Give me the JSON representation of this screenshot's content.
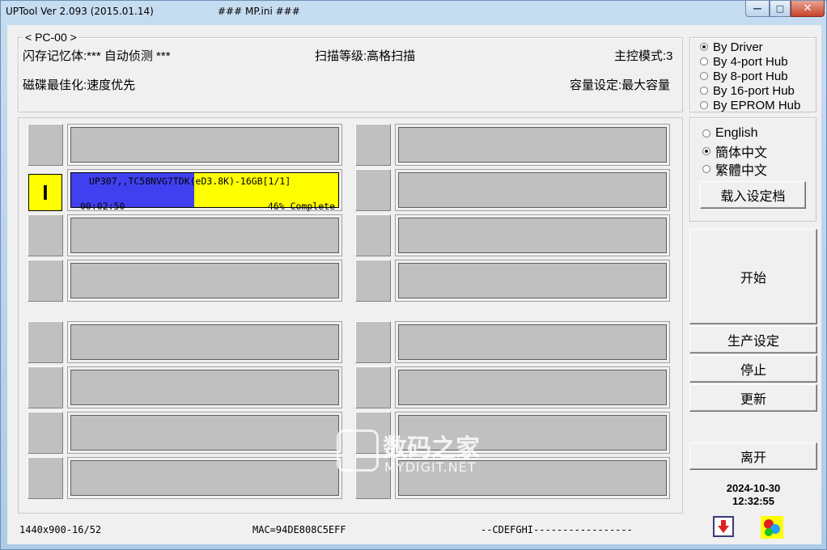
{
  "window": {
    "title": "UPTool Ver 2.093 (2015.01.14)",
    "subtitle": "### MP.ini ###",
    "buttons": {
      "minimize": "—",
      "maximize": "□",
      "close": "✕"
    }
  },
  "info": {
    "group_label": "< PC-00 >",
    "flash": "闪存记忆体:*** 自动侦测 ***",
    "scan": "扫描等级:高格扫描",
    "mode": "主控模式:3",
    "optimize": "磁碟最佳化:速度优先",
    "capacity": "容量设定:最大容量"
  },
  "ports": {
    "active": {
      "slot": 2,
      "indicator": "I",
      "line1": "UP307,,TC58NVG7TDK(eD3.8K)-16GB[1/1]",
      "time": "00:02:50",
      "status": "46% Complete",
      "progress": 0.46,
      "fill_color": "#4040f0",
      "bg_color": "#ffff00"
    },
    "count": 16
  },
  "hub_options": {
    "items": [
      "By Driver",
      "By 4-port Hub",
      "By 8-port Hub",
      "By 16-port Hub",
      "By EPROM Hub"
    ],
    "selected": 0
  },
  "language": {
    "items": [
      "English",
      "簡体中文",
      "繁體中文"
    ],
    "selected": 1,
    "load_button": "载入设定档"
  },
  "buttons": {
    "start": "开始",
    "production": "生产设定",
    "stop": "停止",
    "refresh": "更新",
    "leave": "离开"
  },
  "datetime": {
    "date": "2024-10-30",
    "time": "12:32:55"
  },
  "statusbar": {
    "resolution": "1440x900-16/52",
    "mac": "MAC=94DE808C5EFF",
    "drives": "--CDEFGHI-----------------"
  },
  "watermark": {
    "cn": "数码之家",
    "en": "MYDIGIT.NET"
  },
  "icons": {
    "bottom_left": "download-arrow-icon",
    "bottom_right": "color-dots-icon"
  }
}
